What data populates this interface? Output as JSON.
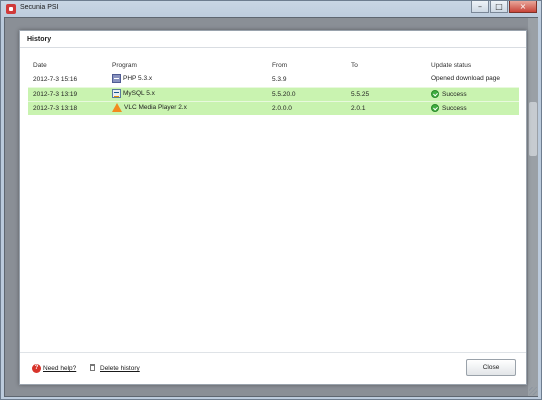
{
  "window": {
    "title": "Secunia PSI",
    "controls": {
      "minimize": "–",
      "maximize": "□",
      "close": "×"
    }
  },
  "dialog": {
    "title": "History",
    "columns": {
      "date": "Date",
      "program": "Program",
      "from": "From",
      "to": "To",
      "status": "Update status"
    },
    "rows": [
      {
        "date": "2012-7-3 15:16",
        "program": "PHP 5.3.x",
        "icon": "php-icon",
        "from": "5.3.9",
        "to": "",
        "status": "Opened download page",
        "highlight": false
      },
      {
        "date": "2012-7-3 13:19",
        "program": "MySQL 5.x",
        "icon": "mysql-icon",
        "from": "5.5.20.0",
        "to": "5.5.25",
        "status": "Success",
        "highlight": true
      },
      {
        "date": "2012-7-3 13:18",
        "program": "VLC Media Player 2.x",
        "icon": "vlc-icon",
        "from": "2.0.0.0",
        "to": "2.0.1",
        "status": "Success",
        "highlight": true
      }
    ],
    "footer": {
      "help_label": "Need help?",
      "delete_label": "Delete history",
      "close_label": "Close"
    }
  },
  "colors": {
    "success_row": "#c9f3b0",
    "success_icon": "#3fae3f",
    "help_icon": "#d8342b"
  }
}
